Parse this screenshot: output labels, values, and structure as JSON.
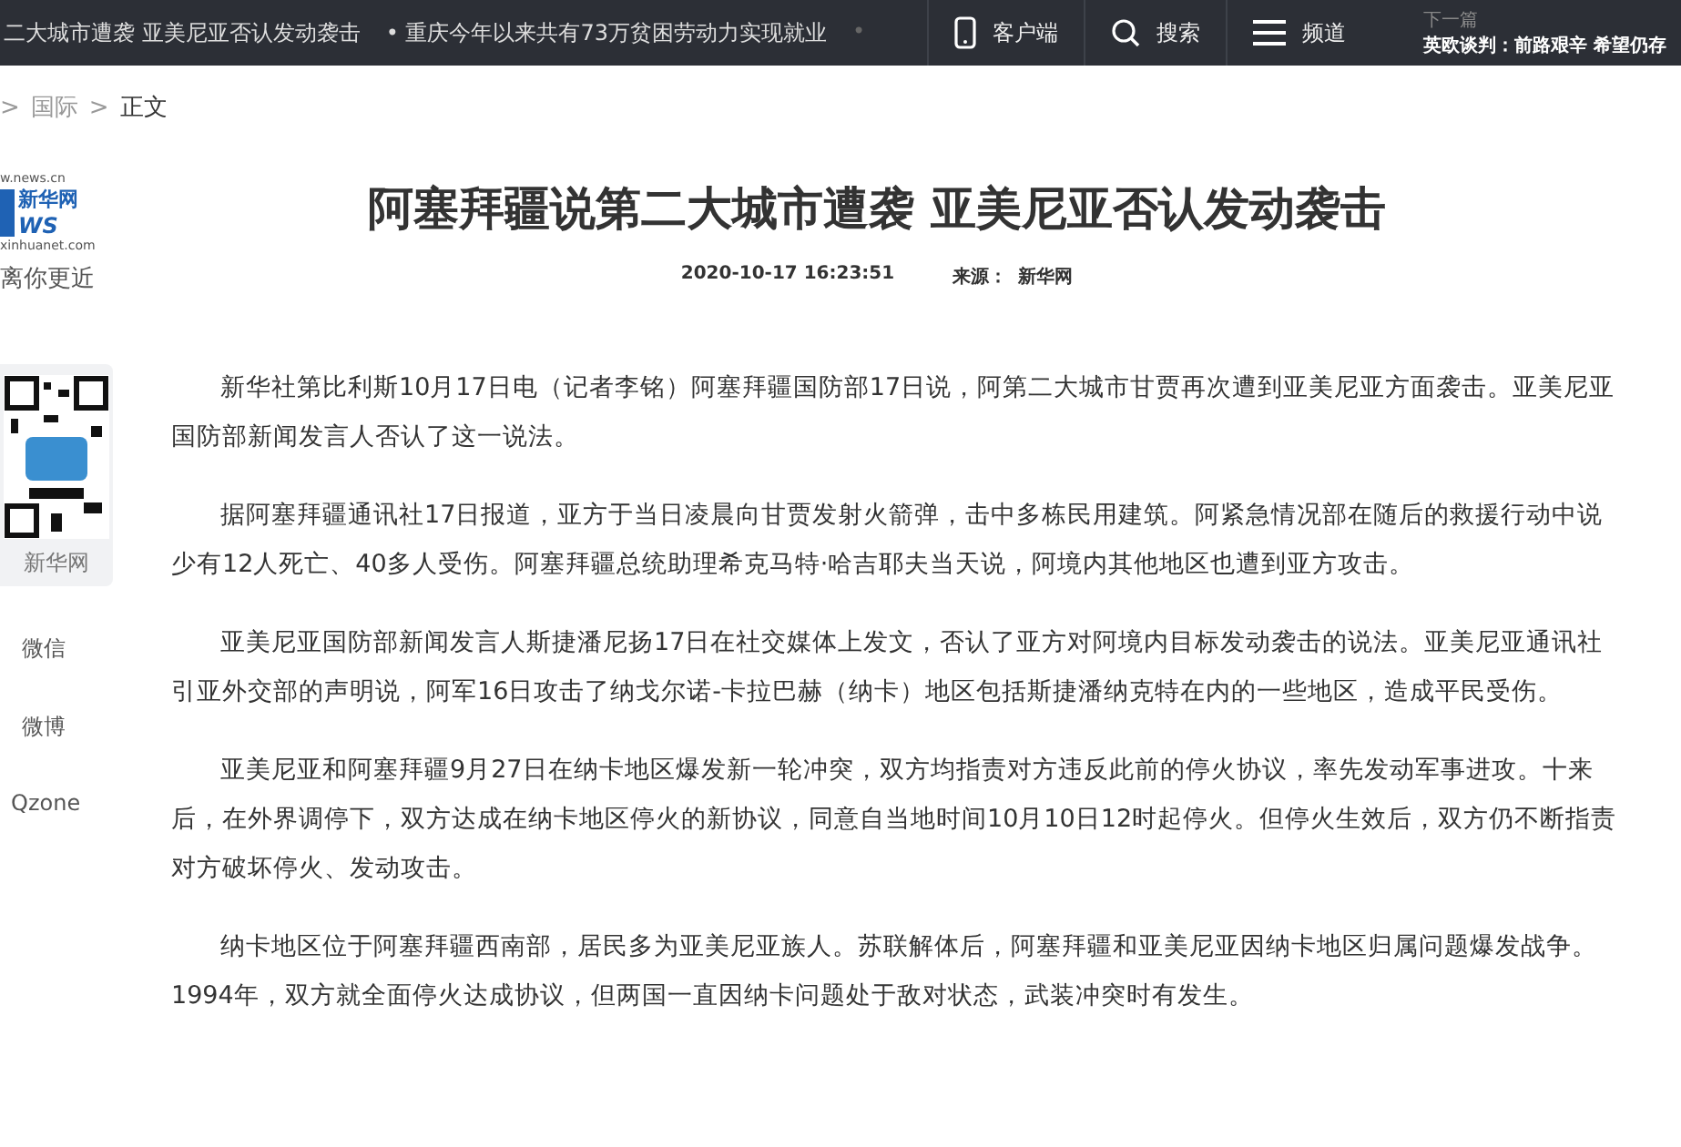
{
  "top_bar": {
    "ticker": [
      "二大城市遭袭 亚美尼亚否认发动袭击",
      "• 重庆今年以来共有73万贫困劳动力实现就业",
      "• "
    ],
    "nav": [
      {
        "kind": "phone",
        "label": "客户端"
      },
      {
        "kind": "search",
        "label": "搜索"
      },
      {
        "kind": "menu",
        "label": "频道"
      }
    ],
    "next": {
      "label": "下一篇",
      "title": "英欧谈判：前路艰辛 希望仍存"
    }
  },
  "breadcrumb": [
    {
      "sep": ">",
      "label": "国际"
    },
    {
      "sep": ">",
      "label": "正文"
    }
  ],
  "logo": {
    "url": "w.news.cn",
    "name": "新华网",
    "news": "WS",
    "domain": "xinhuanet.com",
    "slogan": "离你更近"
  },
  "article": {
    "title": "阿塞拜疆说第二大城市遭袭 亚美尼亚否认发动袭击",
    "time": "2020-10-17 16:23:51",
    "source_label": "来源：",
    "source": "新华网",
    "paragraphs": [
      [
        "新华社第比利斯10月17日电（记者李铭）阿塞拜疆国防部17日说，阿第二大城市甘贾再次遭到亚美尼亚方面袭击。亚美尼亚",
        "国防部新闻发言人否认了这一说法。"
      ],
      [
        "据阿塞拜疆通讯社17日报道，亚方于当日凌晨向甘贾发射火箭弹，击中多栋民用建筑。阿紧急情况部在随后的救援行动中说",
        "少有12人死亡、40多人受伤。阿塞拜疆总统助理希克马特·哈吉耶夫当天说，阿境内其他地区也遭到亚方攻击。"
      ],
      [
        "亚美尼亚国防部新闻发言人斯捷潘尼扬17日在社交媒体上发文，否认了亚方对阿境内目标发动袭击的说法。亚美尼亚通讯社",
        "引亚外交部的声明说，阿军16日攻击了纳戈尔诺-卡拉巴赫（纳卡）地区包括斯捷潘纳克特在内的一些地区，造成平民受伤。"
      ],
      [
        "亚美尼亚和阿塞拜疆9月27日在纳卡地区爆发新一轮冲突，双方均指责对方违反此前的停火协议，率先发动军事进攻。十来",
        "后，在外界调停下，双方达成在纳卡地区停火的新协议，同意自当地时间10月10日12时起停火。但停火生效后，双方仍不断指责",
        "对方破坏停火、发动攻击。"
      ],
      [
        "纳卡地区位于阿塞拜疆西南部，居民多为亚美尼亚族人。苏联解体后，阿塞拜疆和亚美尼亚因纳卡地区归属问题爆发战争。",
        "1994年，双方就全面停火达成协议，但两国一直因纳卡问题处于敌对状态，武装冲突时有发生。"
      ]
    ]
  },
  "share": {
    "qr_caption": "新华网",
    "items": [
      "微信",
      "微博",
      "Qzone"
    ]
  }
}
